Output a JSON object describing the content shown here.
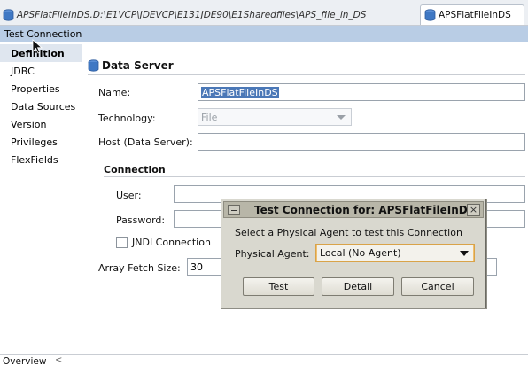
{
  "tabs": {
    "file_path_tab": "APSFlatFileInDS.D:\\E1VCP\\JDEVCP\\E131JDE90\\E1Sharedfiles\\APS_file_in_DS",
    "active_tab": "APSFlatFileInDS"
  },
  "toolbar": {
    "test_connection_label": "Test Connection"
  },
  "sidebar": {
    "items": [
      {
        "label": "Definition"
      },
      {
        "label": "JDBC"
      },
      {
        "label": "Properties"
      },
      {
        "label": "Data Sources"
      },
      {
        "label": "Version"
      },
      {
        "label": "Privileges"
      },
      {
        "label": "FlexFields"
      }
    ]
  },
  "form": {
    "section_title": "Data Server",
    "name_label": "Name:",
    "name_value": "APSFlatFileInDS",
    "technology_label": "Technology:",
    "technology_value": "File",
    "host_label": "Host (Data Server):",
    "connection_title": "Connection",
    "user_label": "User:",
    "password_label": "Password:",
    "jndi_label": "JNDI Connection",
    "array_fetch_label": "Array Fetch Size:",
    "array_fetch_value": "30"
  },
  "bottom": {
    "overview_tab": "Overview",
    "chevron": "<"
  },
  "dialog": {
    "title": "Test Connection for: APSFlatFileInDS",
    "prompt": "Select a Physical Agent to test this Connection",
    "agent_label": "Physical Agent:",
    "agent_value": "Local (No Agent)",
    "test_button": "Test",
    "detail_button": "Detail",
    "cancel_button": "Cancel",
    "close_glyph": "×"
  },
  "colors": {
    "highlight_row": "#b9cde5",
    "selection": "#4b78b7",
    "dialog_bg": "#d9d8cf"
  }
}
